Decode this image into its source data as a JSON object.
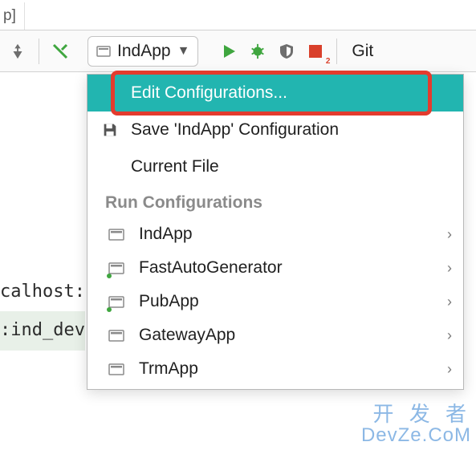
{
  "tab": {
    "label": "p]"
  },
  "toolbar": {
    "run_config_label": "IndApp",
    "git_label": "Git",
    "stop_badge": "2"
  },
  "dropdown": {
    "edit_label": "Edit Configurations...",
    "save_label": "Save 'IndApp' Configuration",
    "current_file_label": "Current File",
    "section_header": "Run Configurations",
    "configs": [
      {
        "label": "IndApp",
        "running": false
      },
      {
        "label": "FastAutoGenerator",
        "running": true
      },
      {
        "label": "PubApp",
        "running": true
      },
      {
        "label": "GatewayApp",
        "running": false
      },
      {
        "label": "TrmApp",
        "running": false
      }
    ]
  },
  "code": {
    "line1": "calhost:",
    "line2": ":ind_dev"
  },
  "watermark": {
    "line1": "开 发 者",
    "line2": "DevZe.CoM"
  }
}
